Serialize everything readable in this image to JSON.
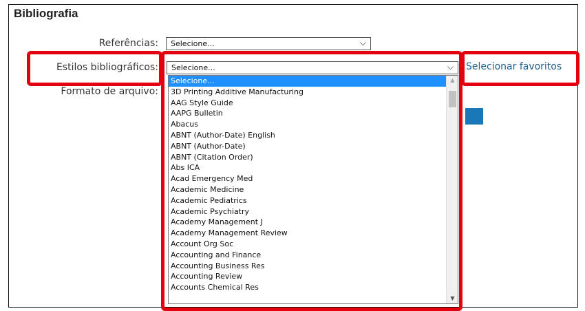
{
  "section": {
    "title": "Bibliografia"
  },
  "referencias": {
    "label": "Referências:",
    "value": "Selecione..."
  },
  "estilos": {
    "label": "Estilos bibliográficos:",
    "value": "Selecione...",
    "favorites_link": "Selecionar favoritos",
    "options": [
      "Selecione...",
      "3D Printing Additive Manufacturing",
      "AAG Style Guide",
      "AAPG Bulletin",
      "Abacus",
      "ABNT (Author-Date) English",
      "ABNT (Author-Date)",
      "ABNT (Citation Order)",
      "Abs ICA",
      "Acad Emergency Med",
      "Academic Medicine",
      "Academic Pediatrics",
      "Academic Psychiatry",
      "Academy Management J",
      "Academy Management Review",
      "Account Org Soc",
      "Accounting and Finance",
      "Accounting Business Res",
      "Accounting Review",
      "Accounts Chemical Res"
    ]
  },
  "formato": {
    "label": "Formato de arquivo:"
  },
  "colors": {
    "highlight": "#e3000f",
    "accent": "#1a78b8",
    "selection": "#1e90ff",
    "link": "#1d5f8e"
  },
  "icons": {
    "dropdown": "chevron-down-icon",
    "scroll_up": "scroll-up-icon",
    "scroll_down": "scroll-down-icon"
  }
}
